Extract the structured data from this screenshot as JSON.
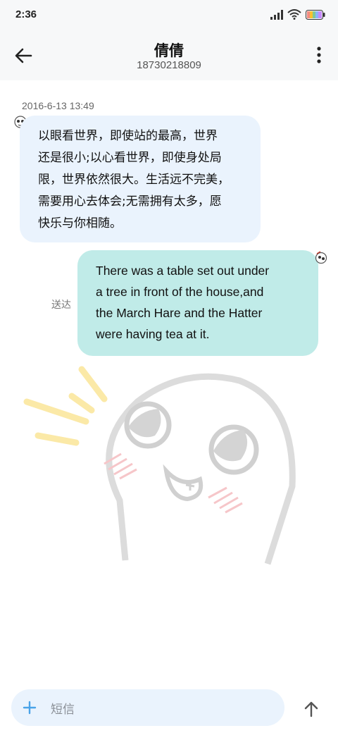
{
  "status_bar": {
    "time": "2:36",
    "icons": [
      "signal-icon",
      "wifi-icon",
      "battery-icon"
    ]
  },
  "header": {
    "contact_name": "倩倩",
    "contact_number": "18730218809",
    "back_icon": "back-arrow-icon",
    "more_icon": "more-vertical-icon"
  },
  "messages": [
    {
      "direction": "incoming",
      "timestamp": "2016-6-13 13:49",
      "lines": [
        "以眼看世界，即使站的最高，世界",
        "还是很小;以心看世界，即使身处局",
        "限，世界依然很大。生活远不完美，",
        "需要用心去体会;无需拥有太多，愿",
        "快乐与你相随。"
      ]
    },
    {
      "direction": "outgoing",
      "status": "送达",
      "lines": [
        "There was a table set out under",
        "a tree in front of the house,and",
        "the March Hare and the Hatter",
        "were having tea at it."
      ]
    }
  ],
  "input": {
    "placeholder": "短信",
    "add_icon": "plus-icon",
    "send_icon": "send-arrow-icon"
  },
  "colors": {
    "incoming_bubble": "#eaf3fd",
    "outgoing_bubble": "#c0ebe8",
    "accent": "#4aa3e8"
  }
}
